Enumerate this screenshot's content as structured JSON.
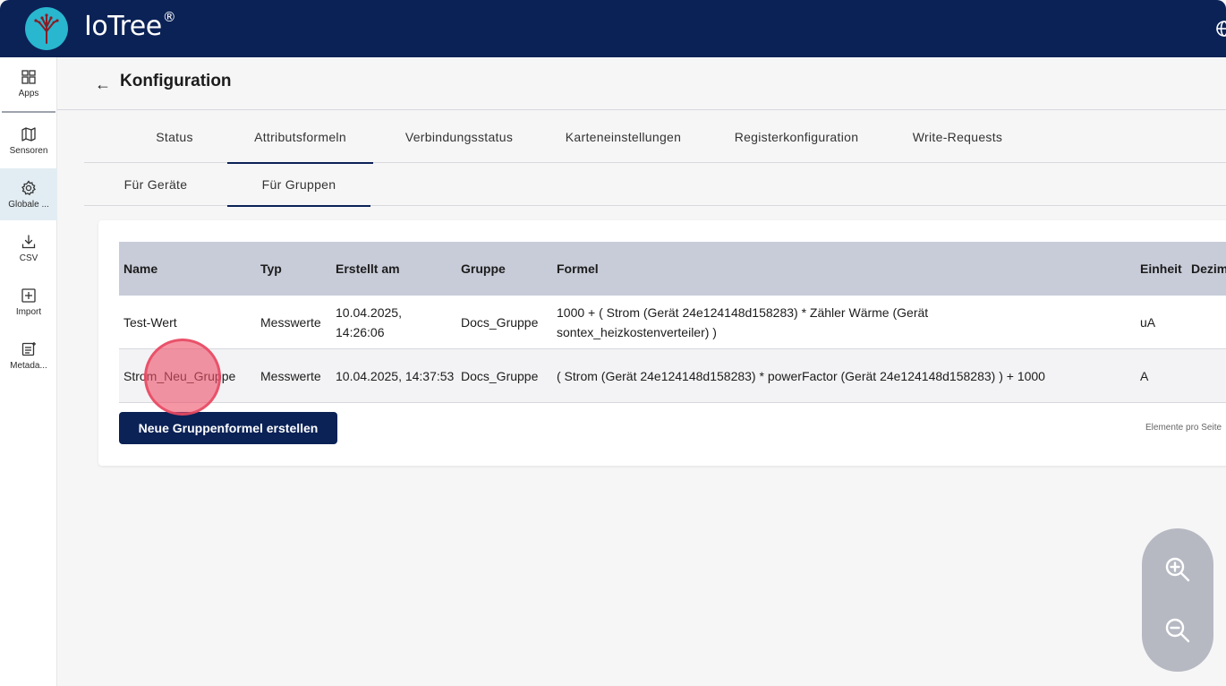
{
  "app": {
    "name": "IoTree",
    "trademark": "®"
  },
  "colors": {
    "topbar": "#0b2256",
    "logo_bg": "#29b6cf",
    "table_header": "#c8ccd8",
    "primary_button": "#0b2256",
    "active_sidebar": "#e2edf3",
    "click_marker": "#ee5069"
  },
  "sidebar": {
    "items": [
      {
        "label": "Apps",
        "icon": "grid-icon"
      },
      {
        "label": "Sensoren",
        "icon": "map-icon"
      },
      {
        "label": "Globale ...",
        "icon": "gear-icon",
        "active": true
      },
      {
        "label": "CSV",
        "icon": "download-icon"
      },
      {
        "label": "Import",
        "icon": "add-box-icon"
      },
      {
        "label": "Metada...",
        "icon": "note-icon"
      }
    ]
  },
  "header": {
    "back_icon": "←",
    "title": "Konfiguration"
  },
  "tabs": [
    "Status",
    "Attributsformeln",
    "Verbindungsstatus",
    "Karteneinstellungen",
    "Registerkonfiguration",
    "Write-Requests"
  ],
  "active_tab": "Attributsformeln",
  "subtabs": [
    "Für Geräte",
    "Für Gruppen"
  ],
  "active_subtab": "Für Gruppen",
  "table": {
    "columns": [
      "Name",
      "Typ",
      "Erstellt am",
      "Gruppe",
      "Formel",
      "Einheit",
      "Dezim"
    ],
    "rows": [
      {
        "name": "Test-Wert",
        "typ": "Messwerte",
        "erstellt_line1": "10.04.2025,",
        "erstellt_line2": "14:26:06",
        "gruppe": "Docs_Gruppe",
        "formel_line1": "1000 + ( Strom (Gerät 24e124148d158283) * Zähler Wärme (Gerät",
        "formel_line2": "sontex_heizkostenverteiler) )",
        "einheit": "uA"
      },
      {
        "name": "Strom_Neu_Gruppe",
        "typ": "Messwerte",
        "erstellt": "10.04.2025, 14:37:53",
        "gruppe": "Docs_Gruppe",
        "formel": "( Strom (Gerät 24e124148d158283) * powerFactor (Gerät 24e124148d158283) ) + 1000",
        "einheit": "A"
      }
    ]
  },
  "actions": {
    "create_button": "Neue Gruppenformel erstellen"
  },
  "pagination": {
    "per_page_label": "Elemente pro Seite"
  },
  "zoom": {
    "in_icon": "zoom-in-icon",
    "out_icon": "zoom-out-icon"
  }
}
